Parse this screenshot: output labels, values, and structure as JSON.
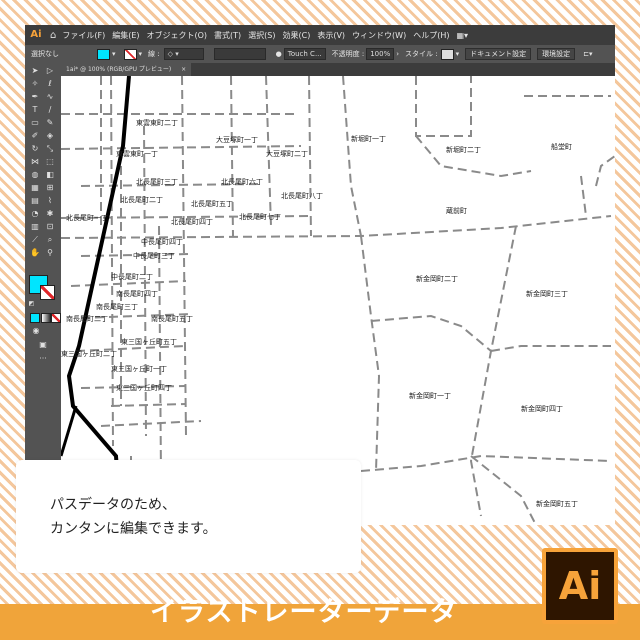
{
  "app": {
    "logo": "Ai",
    "home_icon": "home-icon",
    "menus": [
      "ファイル(F)",
      "編集(E)",
      "オブジェクト(O)",
      "書式(T)",
      "選択(S)",
      "効果(C)",
      "表示(V)",
      "ウィンドウ(W)",
      "ヘルプ(H)"
    ],
    "workspace_icon": "workspace-switcher-icon"
  },
  "control": {
    "selection": "選択なし",
    "fill_color": "#00e5ff",
    "stroke_label": "線 :",
    "brush": "Touch C...",
    "opacity_label": "不透明度 :",
    "opacity_value": "100%",
    "style_label": "スタイル :",
    "doc_settings": "ドキュメント設定",
    "preferences": "環境設定"
  },
  "tab": {
    "title": "1ai* @ 100% (RGB/GPU プレビュー)",
    "close": "×"
  },
  "map_labels": [
    "東雲東町二丁",
    "東雲東町一丁",
    "大豆塚町一丁",
    "大豆塚町二丁",
    "新堀町一丁",
    "新堀町二丁",
    "船堂町",
    "北長尾町三丁",
    "北長尾町六丁",
    "北長尾町二丁",
    "北長尾町五丁",
    "北長尾町八丁",
    "北長尾町一丁",
    "北長尾町四丁",
    "北長尾町七丁",
    "蔵前町",
    "中長尾町四丁",
    "中長尾町三丁",
    "中長尾町二丁",
    "新金岡町二丁",
    "南長尾町四丁",
    "新金岡町三丁",
    "南長尾町三丁",
    "南長尾町二丁",
    "南長尾町五丁",
    "東三国ヶ丘町五丁",
    "東三国ヶ丘町二丁",
    "東三国ヶ丘町一丁",
    "東三国ヶ丘町四丁",
    "新金岡町一丁",
    "新金岡町四丁",
    "新金岡町五丁"
  ],
  "overlay": {
    "line1": "パスデータのため、",
    "line2": "カンタンに編集できます。"
  },
  "footer": {
    "title": "イラストレーターデータ",
    "logo": "Ai"
  },
  "colors": {
    "accent_orange": "#f0a43a",
    "fill_cyan": "#00e5ff"
  }
}
